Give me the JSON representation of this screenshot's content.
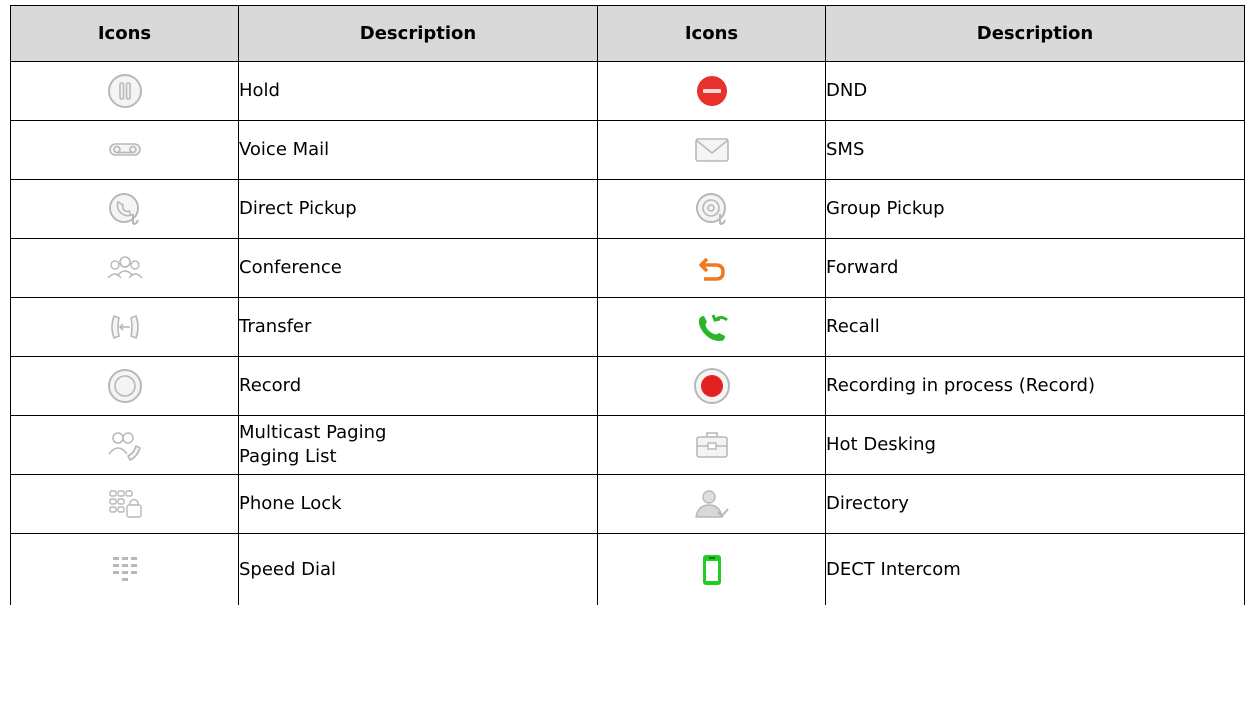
{
  "table": {
    "headers": [
      "Icons",
      "Description",
      "Icons",
      "Description"
    ],
    "rows": [
      {
        "left_icon": "hold-icon",
        "left_desc": [
          "Hold"
        ],
        "right_icon": "dnd-icon",
        "right_desc": [
          "DND"
        ]
      },
      {
        "left_icon": "voice-mail-icon",
        "left_desc": [
          "Voice Mail"
        ],
        "right_icon": "sms-icon",
        "right_desc": [
          "SMS"
        ]
      },
      {
        "left_icon": "direct-pickup-icon",
        "left_desc": [
          "Direct Pickup"
        ],
        "right_icon": "group-pickup-icon",
        "right_desc": [
          "Group Pickup"
        ]
      },
      {
        "left_icon": "conference-icon",
        "left_desc": [
          "Conference"
        ],
        "right_icon": "forward-icon",
        "right_desc": [
          "Forward"
        ]
      },
      {
        "left_icon": "transfer-icon",
        "left_desc": [
          "Transfer"
        ],
        "right_icon": "recall-icon",
        "right_desc": [
          "Recall"
        ]
      },
      {
        "left_icon": "record-icon",
        "left_desc": [
          "Record"
        ],
        "right_icon": "recording-in-process-icon",
        "right_desc": [
          "Recording in process (Record)"
        ]
      },
      {
        "left_icon": "multicast-paging-icon",
        "left_desc": [
          "Multicast Paging",
          "Paging List"
        ],
        "right_icon": "hot-desking-icon",
        "right_desc": [
          "Hot Desking"
        ]
      },
      {
        "left_icon": "phone-lock-icon",
        "left_desc": [
          "Phone Lock"
        ],
        "right_icon": "directory-icon",
        "right_desc": [
          "Directory"
        ]
      },
      {
        "left_icon": "speed-dial-icon",
        "left_desc": [
          "Speed Dial"
        ],
        "right_icon": "dect-intercom-icon",
        "right_desc": [
          "DECT Intercom"
        ]
      }
    ]
  },
  "colors": {
    "header_bg": "#d9d9d9",
    "gray_icon": "#b8b8b8",
    "dnd_red": "#e8302c",
    "forward_orange": "#f07820",
    "recall_green": "#2bb52b",
    "record_red": "#e22222",
    "dect_green": "#22cc22"
  }
}
